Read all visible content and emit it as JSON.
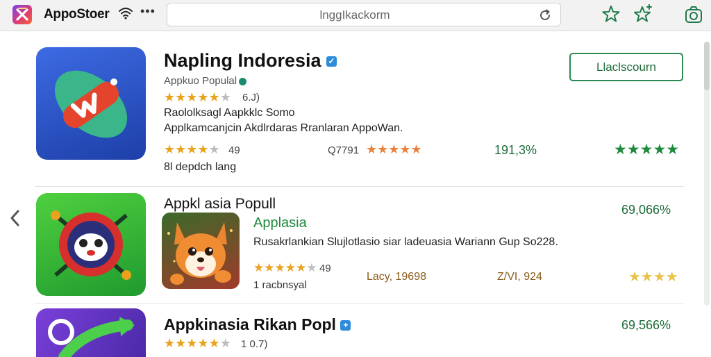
{
  "topbar": {
    "app_name": "AppoStoer",
    "url": "lnggIkackorm",
    "more": "•••"
  },
  "nav": {
    "back": "‹"
  },
  "apps": [
    {
      "title": "Napling Indoresia",
      "subtitle": "Appkuo Populal",
      "rating_a": "6.J)",
      "line1": "Raololksagl Aapkklc Somo",
      "line2": "Applkamcanjcin Akdlrdaras Rranlaran AppoWan.",
      "rating_b": "49",
      "count": "Q7791",
      "percent": "191,3%",
      "tagline": "8l depdch lang",
      "install_label": "Llaclscourn",
      "stars_a": 4.5,
      "stars_b": 4,
      "stars_c": 5,
      "stars_d": 5
    },
    {
      "title": "Appkl asia Popull",
      "percent": "69,066%",
      "sub_title": "Applasia",
      "description": "Rusakrlankian Slujlotlasio siar ladeuasia Wariann Gup So228.",
      "rating": "49",
      "tagline": "1 racbnsyal",
      "meta_a": "Lacy, 19698",
      "meta_b": "Z/VI, 924",
      "stars_a": 4.5,
      "stars_b": 4
    },
    {
      "title": "Appkinasia Rikan Popl",
      "percent": "69,566%",
      "rating": "1 0.7)",
      "stars": 4.5
    }
  ],
  "colors": {
    "accent_green": "#1f8a3d",
    "star_gold": "#e8a21c",
    "verified_blue": "#2d8bd8"
  },
  "icons": [
    "app-logo-icon",
    "wifi-icon",
    "reload-icon",
    "star-outline-icon",
    "star-add-icon",
    "camera-icon",
    "back-arrow-icon",
    "verified-icon"
  ]
}
